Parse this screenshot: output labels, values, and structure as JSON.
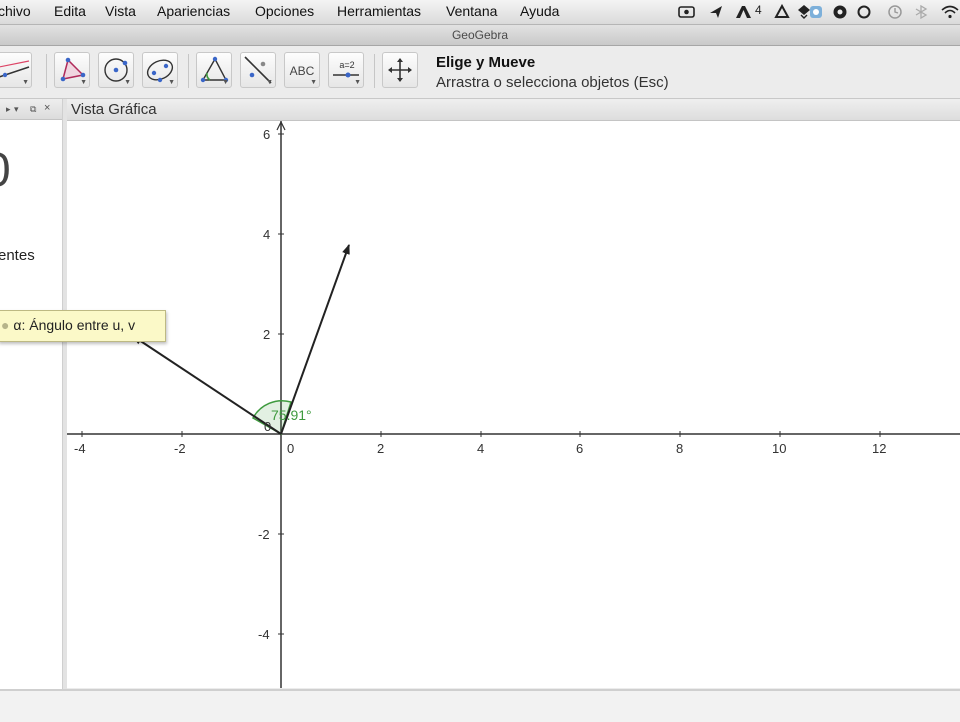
{
  "menubar": {
    "items": [
      "chivo",
      "Edita",
      "Vista",
      "Apariencias",
      "Opciones",
      "Herramientas",
      "Ventana",
      "Ayuda"
    ],
    "tray_badge": "4"
  },
  "window": {
    "title": "GeoGebra"
  },
  "toolbar": {
    "tools": [
      {
        "icon": "line-tool-icon"
      },
      {
        "icon": "triangle-tool-icon"
      },
      {
        "icon": "circle-tool-icon"
      },
      {
        "icon": "conic-tool-icon"
      },
      {
        "icon": "angle-tool-icon"
      },
      {
        "icon": "reflect-tool-icon"
      },
      {
        "icon": "text-tool-icon",
        "label": "ABC"
      },
      {
        "icon": "slider-tool-icon",
        "label": "a=2"
      },
      {
        "icon": "move-graphics-tool-icon"
      }
    ],
    "current_tool_name": "Elige y Mueve",
    "current_tool_help": "Arrastra o selecciona objetos (Esc)"
  },
  "algebra_panel": {
    "partial_text": "entes",
    "partial_bigchar": "0"
  },
  "graphics_view": {
    "title": "Vista Gráfica",
    "x_ticks": [
      "-4",
      "-2",
      "0",
      "2",
      "4",
      "6",
      "8",
      "10",
      "12"
    ],
    "y_ticks": [
      "6",
      "4",
      "2",
      "-2",
      "-4"
    ],
    "origin_label": "0",
    "tooltip": "α: Ángulo entre u, v",
    "angle_label": "75.91°",
    "accent_color": "#3e9a3e"
  }
}
